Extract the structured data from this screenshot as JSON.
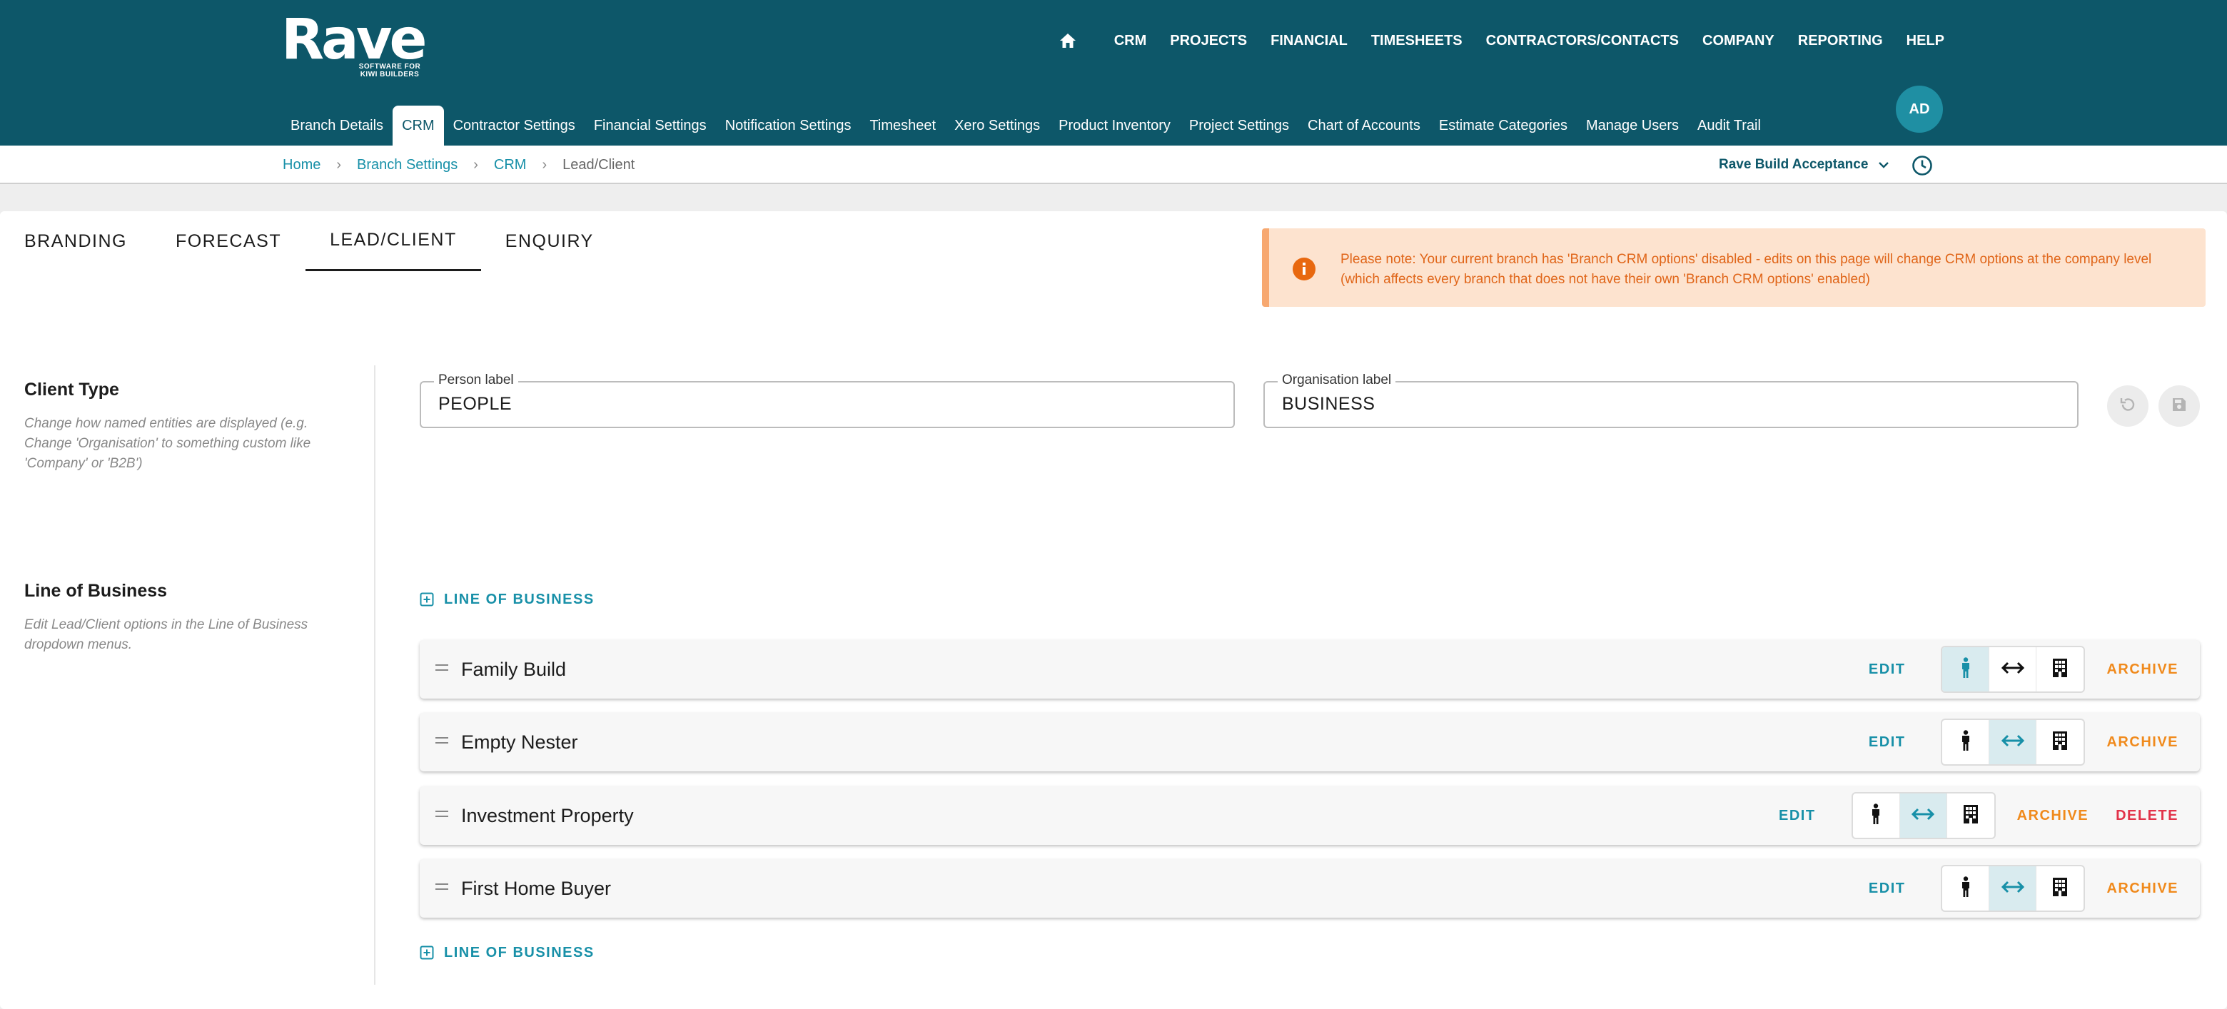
{
  "brand": {
    "name": "Rave",
    "tagline_line1": "SOFTWARE FOR",
    "tagline_line2": "KIWI BUILDERS"
  },
  "main_nav": [
    "CRM",
    "PROJECTS",
    "FINANCIAL",
    "TIMESHEETS",
    "CONTRACTORS/CONTACTS",
    "COMPANY",
    "REPORTING",
    "HELP"
  ],
  "sub_nav": [
    "Branch Details",
    "CRM",
    "Contractor Settings",
    "Financial Settings",
    "Notification Settings",
    "Timesheet",
    "Xero Settings",
    "Product Inventory",
    "Project Settings",
    "Chart of Accounts",
    "Estimate Categories",
    "Manage Users",
    "Audit Trail"
  ],
  "sub_nav_active": "CRM",
  "user": {
    "initials": "AD"
  },
  "breadcrumb": {
    "home": "Home",
    "branch_settings": "Branch Settings",
    "crm": "CRM",
    "current": "Lead/Client"
  },
  "branch": {
    "selected": "Rave Build Acceptance"
  },
  "tabs": [
    "BRANDING",
    "FORECAST",
    "LEAD/CLIENT",
    "ENQUIRY"
  ],
  "active_tab": "LEAD/CLIENT",
  "alert": {
    "text": "Please note: Your current branch has 'Branch CRM options' disabled - edits on this page will change CRM options at the company level (which affects every branch that does not have their own 'Branch CRM options' enabled)"
  },
  "client_type": {
    "title": "Client Type",
    "description": "Change how named entities are displayed (e.g. Change 'Organisation' to something custom like 'Company' or 'B2B')",
    "person_label": "Person label",
    "person_value": "PEOPLE",
    "organisation_label": "Organisation label",
    "organisation_value": "BUSINESS"
  },
  "line_of_business": {
    "title": "Line of Business",
    "description": "Edit Lead/Client options in the Line of Business dropdown menus.",
    "add_label": "LINE OF BUSINESS",
    "edit_label": "EDIT",
    "archive_label": "ARCHIVE",
    "delete_label": "DELETE",
    "items": [
      {
        "name": "Family Build",
        "selected": "person",
        "deletable": false
      },
      {
        "name": "Empty Nester",
        "selected": "both",
        "deletable": false
      },
      {
        "name": "Investment Property",
        "selected": "both",
        "deletable": true
      },
      {
        "name": "First Home Buyer",
        "selected": "both",
        "deletable": false
      }
    ]
  },
  "colors": {
    "header": "#0d5769",
    "accent": "#1890a8",
    "archive": "#f08a1c",
    "delete": "#e2334a",
    "alert_bg": "#fde3cf",
    "alert_text": "#e0661a"
  },
  "icons": [
    "home-icon",
    "chevron-down-icon",
    "history-icon",
    "info-icon",
    "undo-icon",
    "save-icon",
    "add-box-icon",
    "drag-handle-icon",
    "person-icon",
    "swap-horiz-icon",
    "building-icon"
  ]
}
